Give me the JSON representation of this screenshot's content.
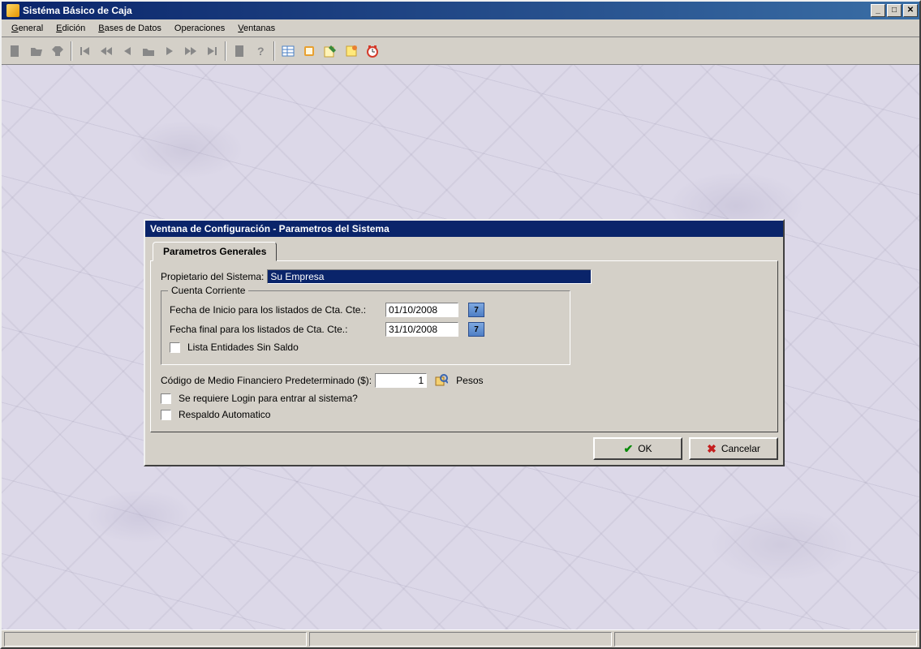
{
  "app": {
    "title": "Sistéma Básico de Caja"
  },
  "menu": {
    "general": "General",
    "edicion": "Edición",
    "bases": "Bases de Datos",
    "operaciones": "Operaciones",
    "ventanas": "Ventanas"
  },
  "toolbar_icons": [
    "new-icon",
    "open-icon",
    "save-icon",
    "sep",
    "first-icon",
    "rewind-icon",
    "prev-icon",
    "folder-icon",
    "next-icon",
    "forward-icon",
    "last-icon",
    "sep",
    "doc-icon",
    "help-icon",
    "sep",
    "grid-icon",
    "book-icon",
    "note-icon",
    "note2-icon",
    "clock-icon"
  ],
  "dialog": {
    "title": "Ventana de Configuración - Parametros del Sistema",
    "tab_label": "Parametros Generales",
    "propietario_label": "Propietario del Sistema:",
    "propietario_value": "Su Empresa",
    "cuenta_corriente": {
      "legend": "Cuenta Corriente",
      "fecha_inicio_label": "Fecha de Inicio para los listados de Cta. Cte.:",
      "fecha_inicio_value": "01/10/2008",
      "fecha_final_label": "Fecha final para los listados de Cta. Cte.:",
      "fecha_final_value": "31/10/2008",
      "lista_sin_saldo_label": "Lista Entidades Sin Saldo",
      "cal_btn_label": "7"
    },
    "codigo_medio_label": "Código de Medio Financiero Predeterminado ($):",
    "codigo_medio_value": "1",
    "codigo_medio_unit": "Pesos",
    "require_login_label": "Se requiere Login para entrar al sistema?",
    "respaldo_label": "Respaldo Automatico",
    "ok_label": "OK",
    "cancel_label": "Cancelar"
  }
}
